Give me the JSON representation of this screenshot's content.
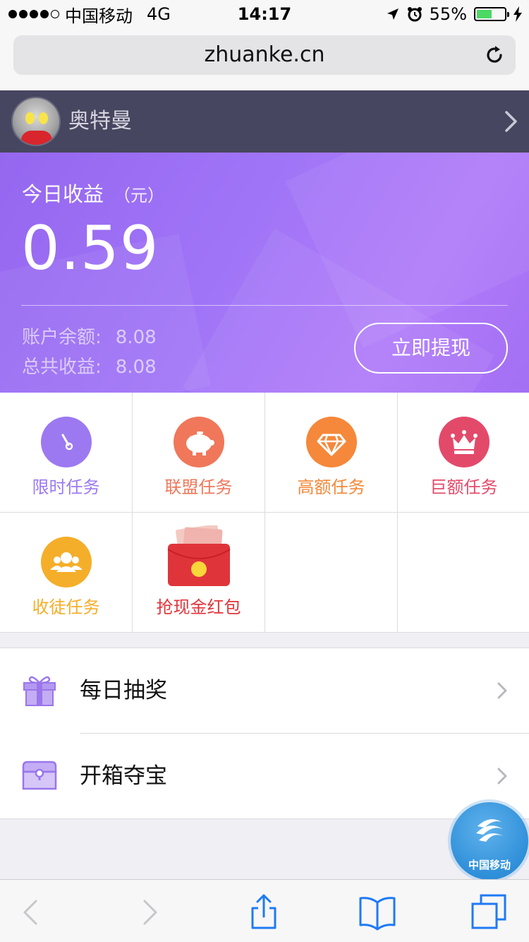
{
  "status_bar": {
    "carrier": "中国移动",
    "network": "4G",
    "time": "14:17",
    "battery_percent": "55%",
    "battery_level": 0.55
  },
  "browser": {
    "url": "zhuanke.cn"
  },
  "user": {
    "name": "奥特曼"
  },
  "earnings": {
    "today_label": "今日收益",
    "today_unit": "（元）",
    "today_value": "0.59",
    "balance_label": "账户余额:",
    "balance_value": "8.08",
    "total_label": "总共收益:",
    "total_value": "8.08",
    "withdraw_label": "立即提现"
  },
  "tasks": [
    {
      "label": "限时任务",
      "icon": "clock-icon",
      "color": "#9c79f1"
    },
    {
      "label": "联盟任务",
      "icon": "piggy-bank-icon",
      "color": "#f0775a"
    },
    {
      "label": "高额任务",
      "icon": "diamond-icon",
      "color": "#f5883a"
    },
    {
      "label": "巨额任务",
      "icon": "crown-icon",
      "color": "#e34a6a"
    },
    {
      "label": "收徒任务",
      "icon": "group-icon",
      "color": "#f5ae2a"
    },
    {
      "label": "抢现金红包",
      "icon": "red-envelope-icon",
      "color": "#e0343b"
    }
  ],
  "list": [
    {
      "label": "每日抽奖",
      "icon": "gift-icon"
    },
    {
      "label": "开箱夺宝",
      "icon": "treasure-chest-icon"
    }
  ],
  "floating_badge": {
    "label": "中国移动"
  },
  "colors": {
    "accent_purple": "#9c6ff4",
    "user_bar": "#474660"
  }
}
